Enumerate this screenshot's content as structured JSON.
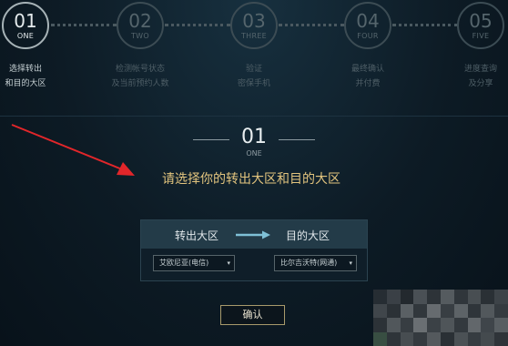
{
  "steps": [
    {
      "number": "01",
      "word": "ONE",
      "desc_line1": "选择转出",
      "desc_line2": "和目的大区",
      "active": true
    },
    {
      "number": "02",
      "word": "TWO",
      "desc_line1": "检测帐号状态",
      "desc_line2": "及当前预约人数",
      "active": false
    },
    {
      "number": "03",
      "word": "THREE",
      "desc_line1": "验证",
      "desc_line2": "密保手机",
      "active": false
    },
    {
      "number": "04",
      "word": "FOUR",
      "desc_line1": "最终确认",
      "desc_line2": "并付费",
      "active": false
    },
    {
      "number": "05",
      "word": "FIVE",
      "desc_line1": "进度查询",
      "desc_line2": "及分享",
      "active": false
    }
  ],
  "section": {
    "number": "01",
    "word": "ONE",
    "instruction": "请选择你的转出大区和目的大区"
  },
  "transfer": {
    "from_label": "转出大区",
    "to_label": "目的大区",
    "from_select": "艾欧尼亚(电信)",
    "to_select": "比尔吉沃特(网通)"
  },
  "confirm_label": "确认",
  "icons": {
    "select_caret": "▾"
  },
  "colors": {
    "accent_gold": "#e2c47e",
    "annotation_red": "#e2262a",
    "transfer_arrow": "#7fc0d6"
  }
}
